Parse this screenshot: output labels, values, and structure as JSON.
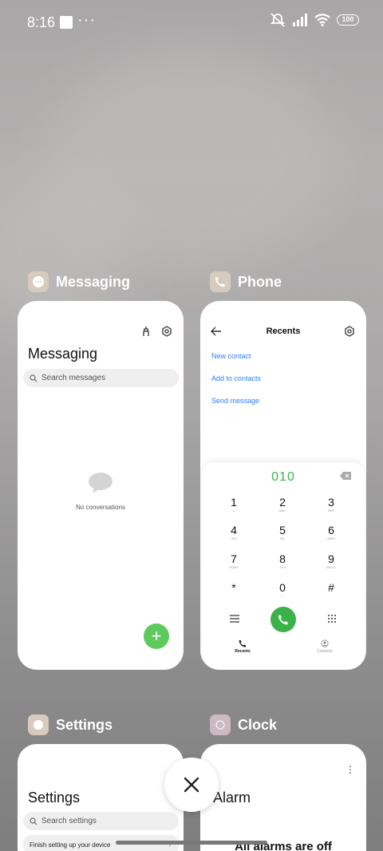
{
  "status_bar": {
    "time": "8:16",
    "battery": "100"
  },
  "apps": [
    {
      "name": "Messaging",
      "card": {
        "title": "Messaging",
        "search_placeholder": "Search messages",
        "empty_text": "No conversations"
      }
    },
    {
      "name": "Phone",
      "card": {
        "title": "Recents",
        "links": [
          "New contact",
          "Add to contacts",
          "Send message"
        ],
        "dialed_number": "010",
        "keys": [
          {
            "digit": "1",
            "letters": "ω"
          },
          {
            "digit": "2",
            "letters": "ABC"
          },
          {
            "digit": "3",
            "letters": "DEF"
          },
          {
            "digit": "4",
            "letters": "GHI"
          },
          {
            "digit": "5",
            "letters": "JKL"
          },
          {
            "digit": "6",
            "letters": "MNO"
          },
          {
            "digit": "7",
            "letters": "PQRS"
          },
          {
            "digit": "8",
            "letters": "TUV"
          },
          {
            "digit": "9",
            "letters": "WXYZ"
          },
          {
            "digit": "*",
            "letters": ","
          },
          {
            "digit": "0",
            "letters": "+"
          },
          {
            "digit": "#",
            "letters": ""
          }
        ],
        "tabs": [
          "Recents",
          "Contacts"
        ]
      }
    },
    {
      "name": "Settings",
      "card": {
        "title": "Settings",
        "search_placeholder": "Search settings",
        "finish_setup": "Finish setting up your device"
      }
    },
    {
      "name": "Clock",
      "card": {
        "title": "Alarm",
        "status": "All alarms are off"
      }
    }
  ],
  "colors": {
    "accent_green": "#3bb14a",
    "fab_green": "#5ec95c",
    "link_blue": "#2f7ef5",
    "icon_beige": "#d7cbbd"
  }
}
